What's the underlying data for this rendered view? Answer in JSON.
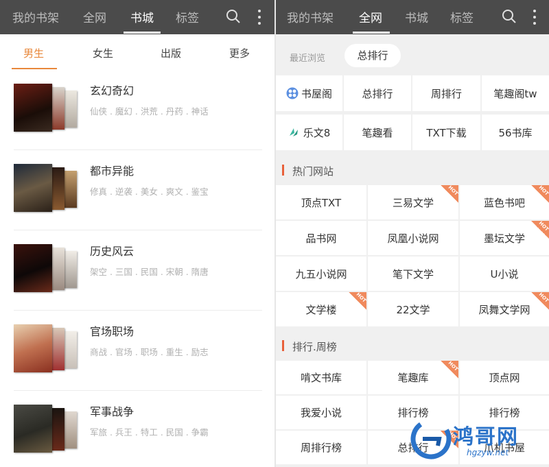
{
  "left": {
    "topbar": {
      "tabs": [
        "我的书架",
        "全网",
        "书城",
        "标签"
      ],
      "active_tab": "书城"
    },
    "subtabs": [
      "男生",
      "女生",
      "出版",
      "更多"
    ],
    "active_subtab": "男生",
    "categories": [
      {
        "title": "玄幻奇幻",
        "tags": "仙侠 . 魔幻 . 洪荒 . 丹药 . 神话"
      },
      {
        "title": "都市异能",
        "tags": "修真 . 逆袭 . 美女 . 爽文 . 鉴宝"
      },
      {
        "title": "历史风云",
        "tags": "架空 . 三国 . 民国 . 宋朝 . 隋唐"
      },
      {
        "title": "官场职场",
        "tags": "商战 . 官场 . 职场 . 重生 . 励志"
      },
      {
        "title": "军事战争",
        "tags": "军旅 . 兵王 . 特工 . 民国 . 争霸"
      }
    ]
  },
  "right": {
    "topbar": {
      "tabs": [
        "我的书架",
        "全网",
        "书城",
        "标签"
      ],
      "active_tab": "全网"
    },
    "recent_label": "最近浏览",
    "pill_label": "总排行",
    "quick_row1": [
      "书屋阁",
      "总排行",
      "周排行",
      "笔趣阁tw"
    ],
    "quick_row2": [
      "乐文8",
      "笔趣看",
      "TXT下载",
      "56书库"
    ],
    "hot_section_title": "热门网站",
    "hot_sites": [
      {
        "name": "顶点TXT",
        "hot": false
      },
      {
        "name": "三易文学",
        "hot": true
      },
      {
        "name": "蓝色书吧",
        "hot": true
      },
      {
        "name": "品书网",
        "hot": false
      },
      {
        "name": "凤凰小说网",
        "hot": false
      },
      {
        "name": "墨坛文学",
        "hot": true
      },
      {
        "name": "九五小说网",
        "hot": false
      },
      {
        "name": "笔下文学",
        "hot": false
      },
      {
        "name": "U小说",
        "hot": false
      },
      {
        "name": "文学楼",
        "hot": true
      },
      {
        "name": "22文学",
        "hot": false
      },
      {
        "name": "凤舞文学网",
        "hot": true
      }
    ],
    "rank_section_title": "排行.周榜",
    "rank_sites": [
      {
        "name": "啃文书库",
        "hot": false
      },
      {
        "name": "笔趣库",
        "hot": true
      },
      {
        "name": "顶点网",
        "hot": false
      },
      {
        "name": "我爱小说",
        "hot": false
      },
      {
        "name": "排行榜",
        "hot": false
      },
      {
        "name": "排行榜",
        "hot": false
      },
      {
        "name": "周排行榜",
        "hot": false
      },
      {
        "name": "总排行",
        "hot": true
      },
      {
        "name": "爪机书屋",
        "hot": false
      }
    ],
    "hot_badge": "HOT"
  },
  "watermark": {
    "name": "鸿哥网",
    "url": "hgzyw.net"
  },
  "colors": {
    "topbar": "#4b4b4b",
    "accent": "#e8873a",
    "section_bar": "#e8603a",
    "hot": "#f08a5d"
  }
}
